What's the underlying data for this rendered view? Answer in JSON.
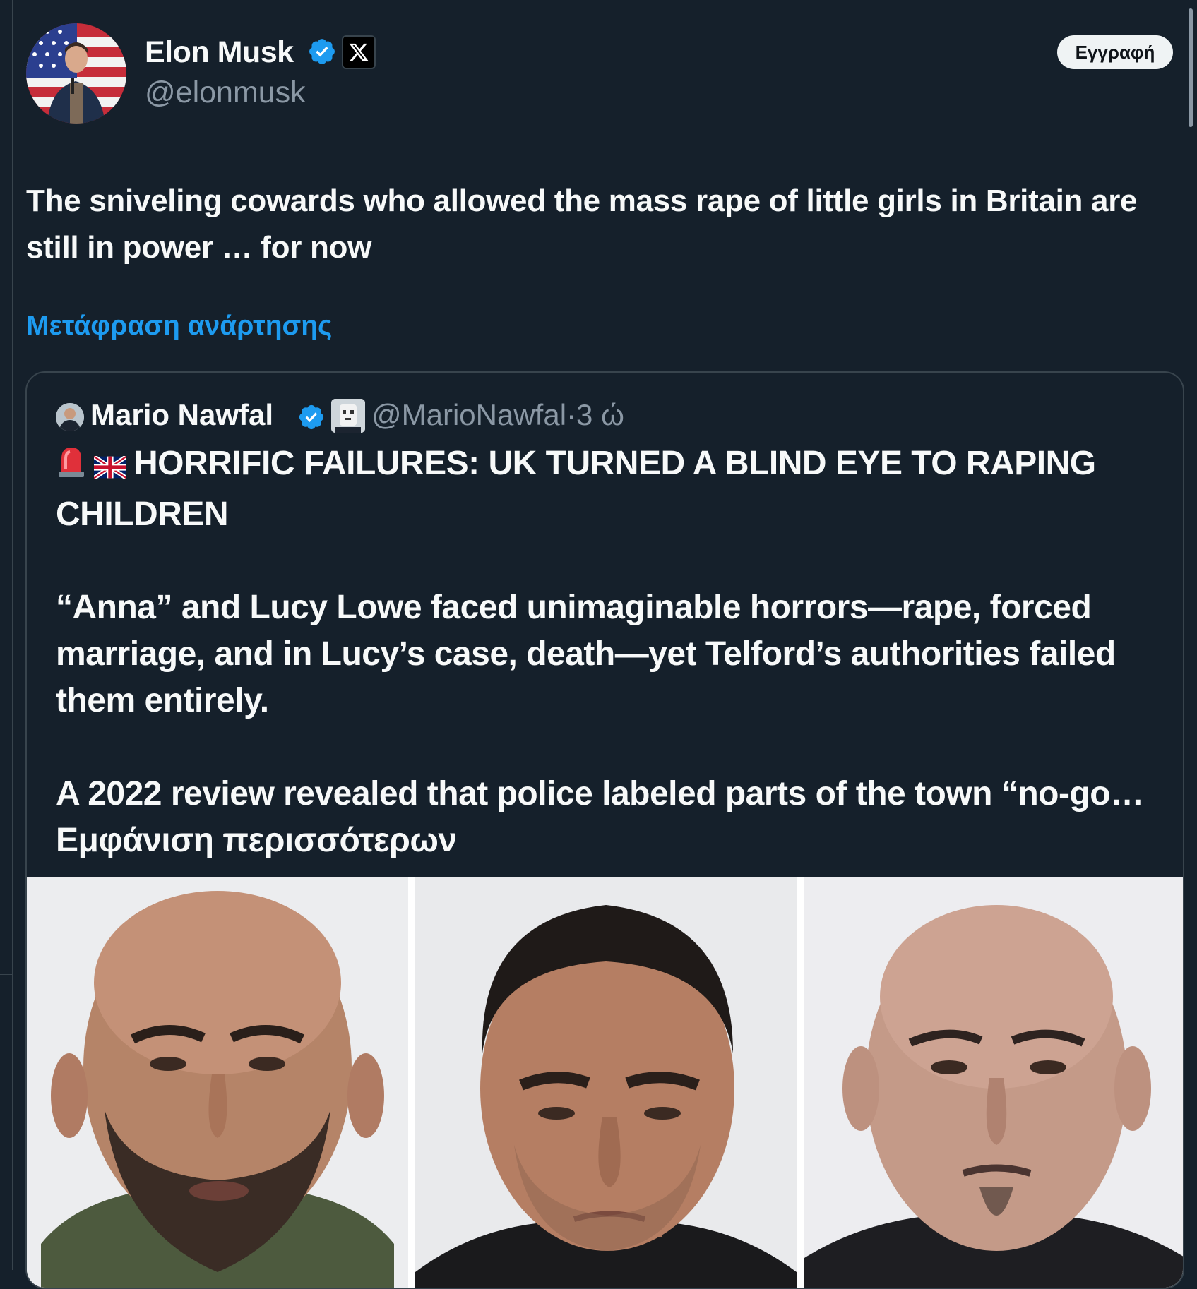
{
  "header": {
    "author_name": "Elon Musk",
    "author_handle": "@elonmusk",
    "signup_label": "Εγγραφή"
  },
  "post": {
    "text": "The sniveling cowards who allowed the mass rape of little girls in Britain are still in power … for now",
    "translate_label": "Μετάφραση ανάρτησης"
  },
  "quote": {
    "author_name": "Mario Nawfal",
    "author_handle": "@MarioNawfal",
    "separator": "·",
    "time": "3 ώ",
    "headline": "HORRIFIC FAILURES: UK TURNED A BLIND EYE TO RAPING CHILDREN",
    "paragraph1": "“Anna” and Lucy Lowe faced unimaginable horrors—rape, forced marriage, and in Lucy’s case, death—yet Telford’s authorities failed them entirely.",
    "paragraph2": "A 2022 review revealed that police labeled parts of the town “no-go…",
    "show_more_label": "Εμφάνιση περισσότερων"
  },
  "icons": {
    "verified": "verified-badge-icon",
    "x_logo": "x-logo-icon",
    "siren": "siren-emoji-icon",
    "uk_flag": "uk-flag-emoji-icon"
  },
  "colors": {
    "background": "#15202b",
    "text": "#f7f9f9",
    "muted": "#8b98a5",
    "link": "#1d9bf0",
    "border": "#38444d",
    "verified": "#1d9bf0"
  }
}
